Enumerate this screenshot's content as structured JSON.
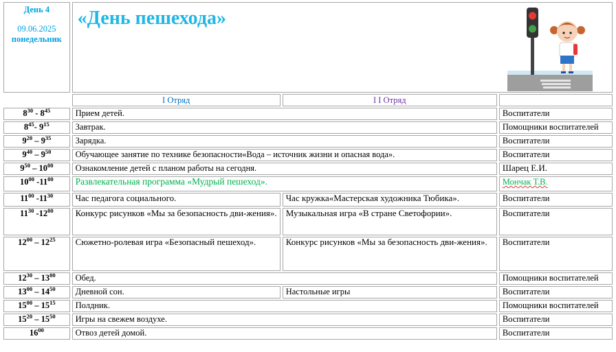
{
  "header": {
    "day": "День 4",
    "date": "09.06.2025",
    "weekday": "понедельник",
    "title": "«День  пешехода»",
    "squad1": "I Отряд",
    "squad2": "I I Отряд"
  },
  "rows": [
    {
      "t1": "8",
      "s1": "30",
      "t2": " - 8",
      "s2": "45",
      "a": "Прием детей.",
      "r": "Воспитатели"
    },
    {
      "t1": "8",
      "s1": "45",
      "t2": "- 9",
      "s2": "15",
      "a": "Завтрак.",
      "r": "Помощники воспитателей"
    },
    {
      "t1": "9",
      "s1": "20",
      "t2": " – 9",
      "s2": "35",
      "a": "Зарядка.",
      "r": "Воспитатели"
    },
    {
      "t1": "9",
      "s1": "40",
      "t2": " – 9",
      "s2": "50",
      "a": "Обучающее занятие по технике безопасности«Вода – источник жизни и  опасная вода».",
      "r": "Воспитатели"
    },
    {
      "t1": "9",
      "s1": "50",
      "t2": " – 10",
      "s2": "00",
      "a": "Ознакомление детей  с планом работы на сегодня.",
      "r": "Шарец Е.И."
    },
    {
      "t1": "10",
      "s1": "00",
      "t2": " -11",
      "s2": "00",
      "a": "Развлекательная программа «Мудрый  пешеход».",
      "r": "Мончак Т.В."
    },
    {
      "t1": "11",
      "s1": "00",
      "t2": " -11",
      "s2": "30",
      "a": "Час педагога социального.",
      "b": "Час кружка«Мастерская  художника Тюбика».",
      "r": "Воспитатели"
    },
    {
      "t1": "11",
      "s1": "30",
      "t2": " -12",
      "s2": "00",
      "a": "Конкурс рисунков  «Мы за безопасность дви-жения».",
      "b": "Музыкальная игра «В стране Светофории».",
      "r": "Воспитатели"
    },
    {
      "t1": "12",
      "s1": "00",
      "t2": " – 12",
      "s2": "25",
      "a": "Сюжетно-ролевая игра «Безопасный пешеход».",
      "b": "Конкурс рисунков  «Мы за безопасность дви-жения».",
      "r": "Воспитатели"
    },
    {
      "t1": "12",
      "s1": "30",
      "t2": " – 13",
      "s2": "00",
      "a": "Обед.",
      "r": "Помощники воспитателей"
    },
    {
      "t1": "13",
      "s1": "00",
      "t2": " – 14",
      "s2": "50",
      "a": "Дневной сон.",
      "b": "Настольные игры",
      "r": "Воспитатели"
    },
    {
      "t1": "15",
      "s1": "00",
      "t2": " – 15",
      "s2": "15",
      "a": "Полдник.",
      "r": "Помощники воспитателей"
    },
    {
      "t1": "15",
      "s1": "20",
      "t2": " – 15",
      "s2": "50",
      "a": "Игры на свежем воздухе.",
      "r": "Воспитатели"
    },
    {
      "t1": "16",
      "s1": "00",
      "t2": "",
      "s2": "",
      "a": "Отвоз детей домой.",
      "r": "Воспитатели"
    }
  ],
  "illustration": {
    "icons": [
      "traffic-light-icon",
      "girl-pedestrian-icon",
      "crosswalk-icon"
    ],
    "colors": {
      "red": "#e53935",
      "green": "#43a047",
      "road": "#8c8c8c",
      "sky": "#cfe8f3"
    }
  }
}
